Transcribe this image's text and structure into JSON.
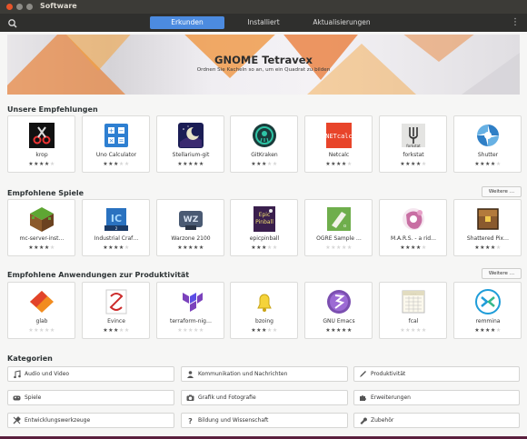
{
  "window": {
    "title": "Software"
  },
  "tabs": [
    {
      "label": "Erkunden",
      "active": true
    },
    {
      "label": "Installiert",
      "active": false
    },
    {
      "label": "Aktualisierungen",
      "active": false
    }
  ],
  "banner": {
    "title": "GNOME Tetravex",
    "subtitle": "Ordnen Sie Kacheln so an, um ein Quadrat zu bilden"
  },
  "sections": [
    {
      "title": "Unsere Empfehlungen",
      "more_label": "",
      "apps": [
        {
          "name": "krop",
          "stars": 4,
          "icon": "krop-icon"
        },
        {
          "name": "Uno Calculator",
          "stars": 3,
          "icon": "calculator-icon"
        },
        {
          "name": "Stellarium-git",
          "stars": 5,
          "icon": "stellarium-icon"
        },
        {
          "name": "GitKraken",
          "stars": 3,
          "icon": "gitkraken-icon"
        },
        {
          "name": "Netcalc",
          "stars": 4,
          "icon": "netcalc-icon"
        },
        {
          "name": "forkstat",
          "stars": 4,
          "icon": "forkstat-icon"
        },
        {
          "name": "Shutter",
          "stars": 4,
          "icon": "shutter-icon"
        }
      ]
    },
    {
      "title": "Empfohlene Spiele",
      "more_label": "Weitere …",
      "apps": [
        {
          "name": "mc-server-inst…",
          "stars": 4,
          "icon": "minecraft-icon"
        },
        {
          "name": "Industrial Craf…",
          "stars": 4,
          "icon": "industrial-craft-icon"
        },
        {
          "name": "Warzone 2100",
          "stars": 5,
          "icon": "warzone-icon"
        },
        {
          "name": "epicpinball",
          "stars": 3,
          "icon": "pinball-icon"
        },
        {
          "name": "OGRE Sample …",
          "stars": 0,
          "icon": "ogre-icon"
        },
        {
          "name": "M.A.R.S. - a rid…",
          "stars": 4,
          "icon": "mars-icon"
        },
        {
          "name": "Shattered Pix…",
          "stars": 4,
          "icon": "shattered-pixel-icon"
        }
      ]
    },
    {
      "title": "Empfohlene Anwendungen zur Produktivität",
      "more_label": "Weitere …",
      "apps": [
        {
          "name": "glab",
          "stars": 0,
          "icon": "glab-icon"
        },
        {
          "name": "Evince",
          "stars": 3,
          "icon": "evince-icon"
        },
        {
          "name": "terraform-nig…",
          "stars": 0,
          "icon": "terraform-icon"
        },
        {
          "name": "bzoing",
          "stars": 3,
          "icon": "bell-icon"
        },
        {
          "name": "GNU Emacs",
          "stars": 5,
          "icon": "emacs-icon"
        },
        {
          "name": "fcal",
          "stars": 0,
          "icon": "calendar-icon"
        },
        {
          "name": "remmina",
          "stars": 4,
          "icon": "remmina-icon"
        }
      ]
    }
  ],
  "categories_title": "Kategorien",
  "categories": [
    {
      "label": "Audio und Video",
      "icon": "music-note-icon"
    },
    {
      "label": "Kommunikation und Nachrichten",
      "icon": "person-icon"
    },
    {
      "label": "Produktivität",
      "icon": "pencil-icon"
    },
    {
      "label": "Spiele",
      "icon": "gamepad-icon"
    },
    {
      "label": "Grafik und Fotografie",
      "icon": "camera-icon"
    },
    {
      "label": "Erweiterungen",
      "icon": "puzzle-icon"
    },
    {
      "label": "Entwicklungswerkzeuge",
      "icon": "tools-icon"
    },
    {
      "label": "Bildung und Wissenschaft",
      "icon": "question-icon"
    },
    {
      "label": "Zubehör",
      "icon": "wrench-icon"
    }
  ]
}
